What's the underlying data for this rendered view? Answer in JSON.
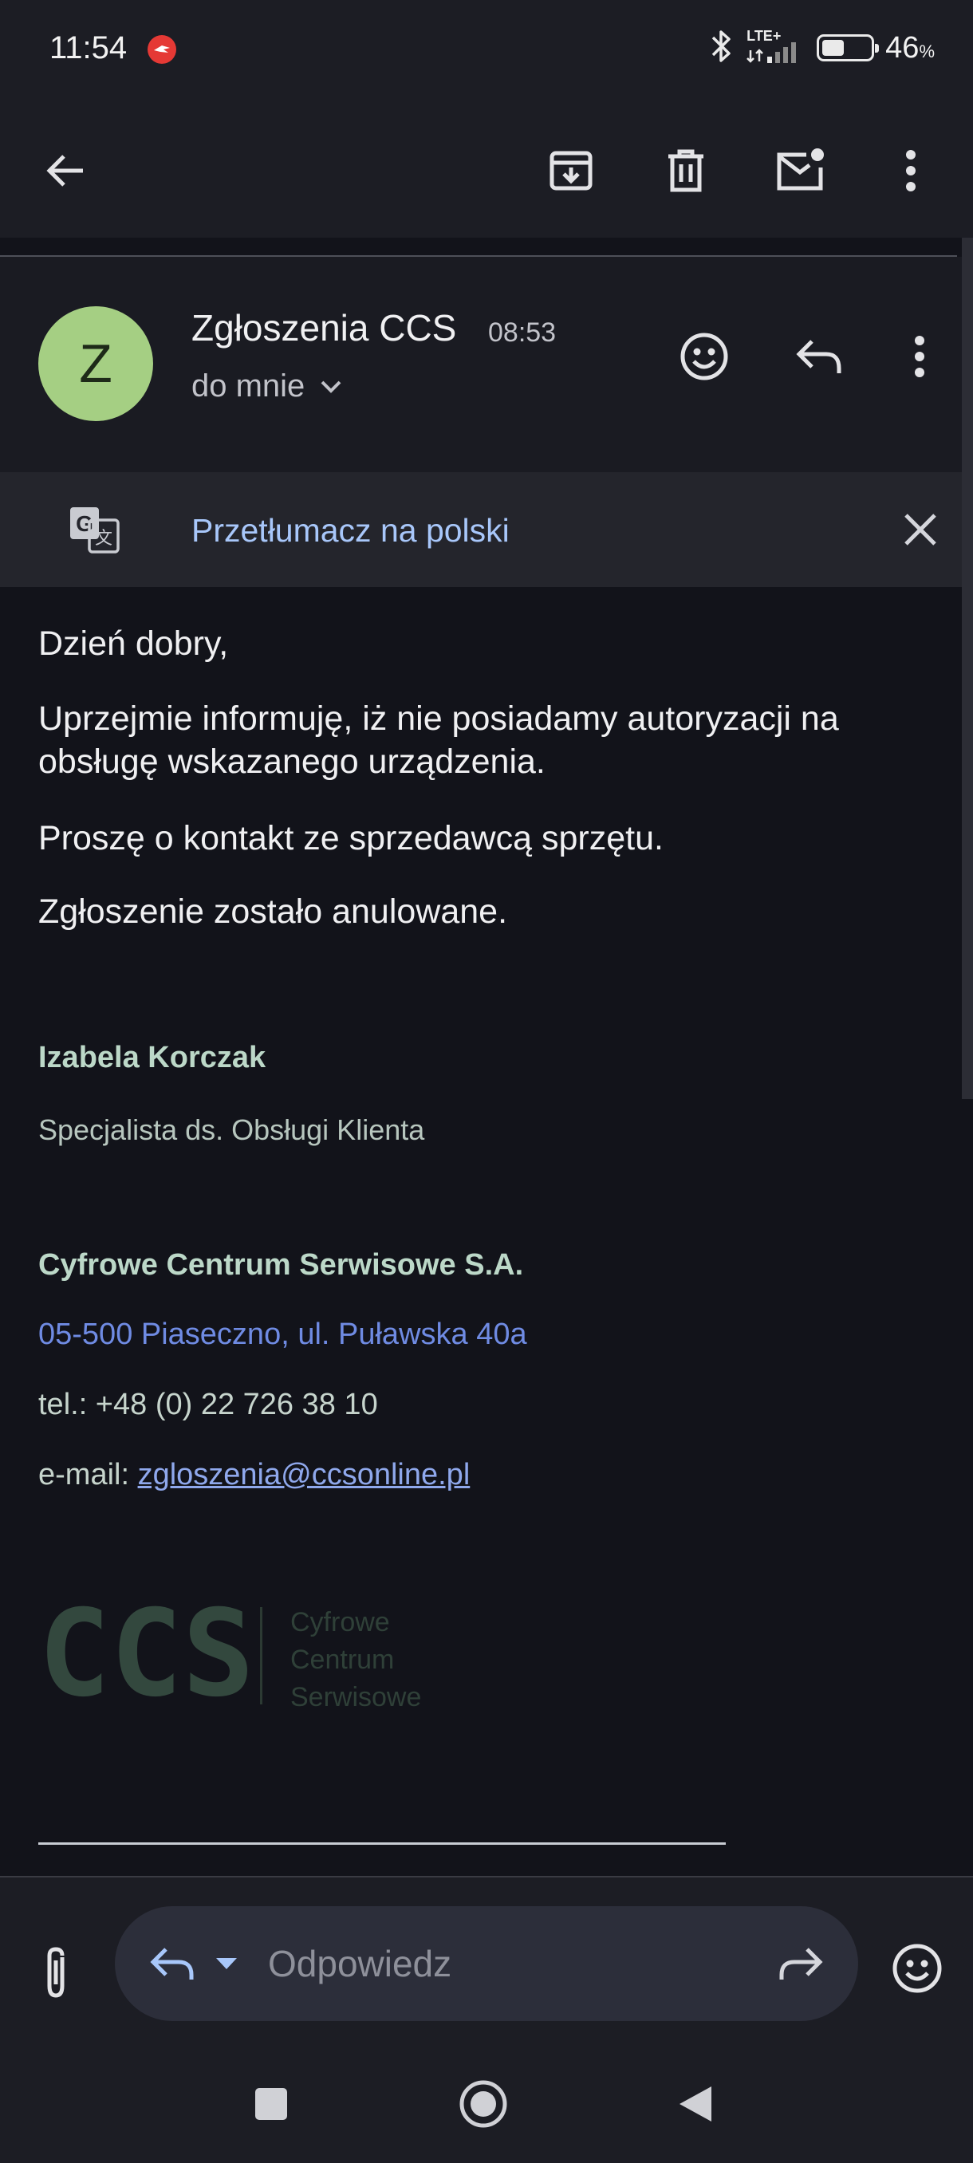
{
  "status_bar": {
    "time": "11:54",
    "network": "LTE+",
    "battery_value": "46",
    "battery_unit": "%",
    "battery_level": 0.46
  },
  "toolbar": {
    "back_icon": "arrow-back-icon",
    "archive_icon": "archive-icon",
    "delete_icon": "trash-icon",
    "mark_unread_icon": "mail-unread-icon",
    "more_icon": "more-vert-icon"
  },
  "message": {
    "sender_name": "Zgłoszenia CCS",
    "sender_initial": "Z",
    "avatar_color": "#a5cf83",
    "time": "08:53",
    "recipient": "do mnie",
    "body": [
      "Dzień dobry,",
      "Uprzejmie informuję, iż nie posiadamy autoryzacji na obsługę wskazanego urządzenia.",
      "Proszę o kontakt ze sprzedawcą sprzętu.",
      "Zgłoszenie zostało anulowane."
    ]
  },
  "translate_bar": {
    "label": "Przetłumacz na polski",
    "accent": "#a8c7fa"
  },
  "signature": {
    "name": "Izabela Korczak",
    "title": "Specjalista ds. Obsługi Klienta",
    "company": "Cyfrowe Centrum Serwisowe S.A.",
    "address": "05-500 Piaseczno, ul. Puławska 40a",
    "phone": "tel.: +48 (0) 22 726 38 10",
    "email_label": "e-mail: ",
    "email": "zgloszenia@ccsonline.pl",
    "logo_text": "CCS",
    "logo_lines": [
      "Cyfrowe",
      "Centrum",
      "Serwisowe"
    ]
  },
  "reply": {
    "placeholder": "Odpowiedz"
  },
  "colors": {
    "background": "#12131a",
    "bar": "#1c1d24",
    "link": "#6f8be3"
  }
}
